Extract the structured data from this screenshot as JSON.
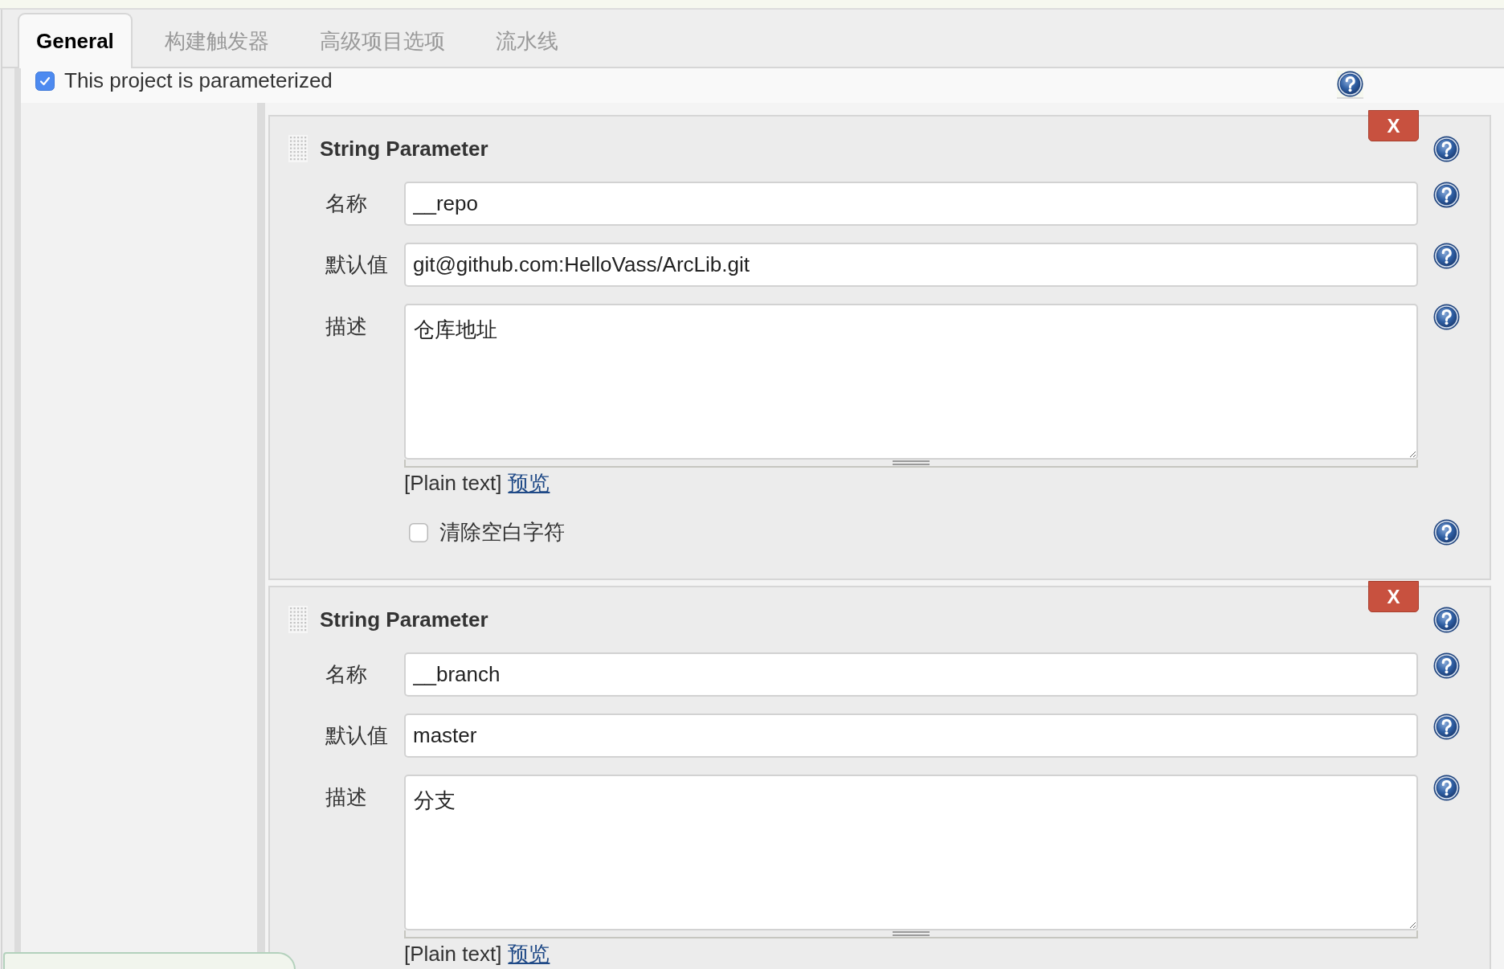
{
  "tabs": [
    {
      "label": "General",
      "selected": true
    },
    {
      "label": "构建触发器",
      "selected": false
    },
    {
      "label": "高级项目选项",
      "selected": false
    },
    {
      "label": "流水线",
      "selected": false
    }
  ],
  "parameterized": {
    "label": "This project is parameterized",
    "checked": true
  },
  "parameters": [
    {
      "title": "String Parameter",
      "remove_label": "X",
      "fields": [
        {
          "kind": "input",
          "label": "名称",
          "value": "__repo"
        },
        {
          "kind": "input",
          "label": "默认值",
          "value": "git@github.com:HelloVass/ArcLib.git"
        },
        {
          "kind": "textarea",
          "label": "描述",
          "value": "仓库地址"
        }
      ],
      "format_note": "[Plain text]",
      "preview_link": "预览",
      "trim": {
        "label": "清除空白字符",
        "checked": false
      }
    },
    {
      "title": "String Parameter",
      "remove_label": "X",
      "fields": [
        {
          "kind": "input",
          "label": "名称",
          "value": "__branch"
        },
        {
          "kind": "input",
          "label": "默认值",
          "value": "master"
        },
        {
          "kind": "textarea",
          "label": "描述",
          "value": "分支"
        }
      ],
      "format_note": "[Plain text]",
      "preview_link": "预览"
    }
  ]
}
